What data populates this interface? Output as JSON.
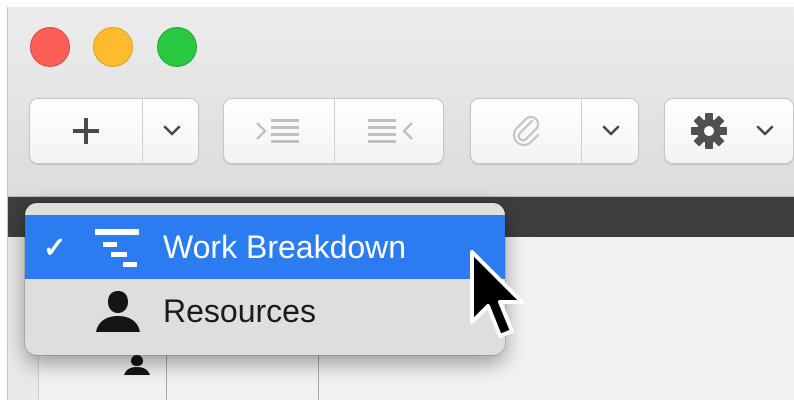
{
  "window": {
    "toolbar": {
      "add_icon": "plus-icon",
      "add_menu_icon": "chevron-down-icon",
      "indent_icon": "indent-icon",
      "outdent_icon": "outdent-icon",
      "link_icon": "paperclip-icon",
      "link_menu_icon": "chevron-down-icon",
      "settings_icon": "gear-icon",
      "settings_menu_icon": "chevron-down-icon"
    }
  },
  "view_menu": {
    "items": [
      {
        "label": "Work Breakdown",
        "icon": "work-breakdown-icon",
        "checked": true,
        "check_mark": "✓"
      },
      {
        "label": "Resources",
        "icon": "person-icon",
        "checked": false
      }
    ]
  },
  "colors": {
    "selection": "#2a7cf0",
    "menu_bg": "#dedede",
    "dark_bar": "#3e3e3e",
    "close": "#fc5f57",
    "minimize": "#fdbc2e",
    "zoom": "#29c840"
  }
}
